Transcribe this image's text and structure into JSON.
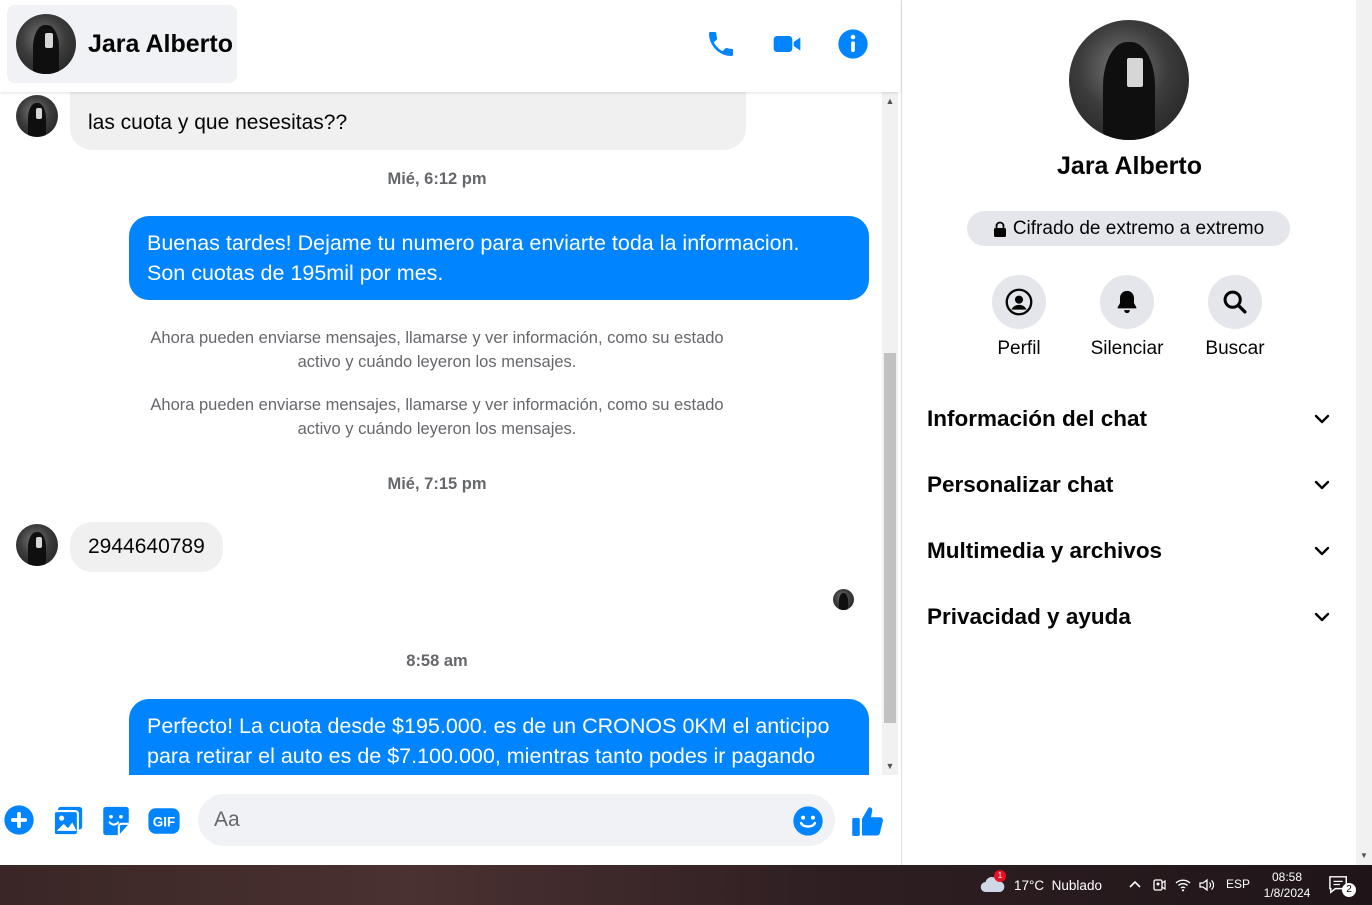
{
  "contact": {
    "name": "Jara Alberto"
  },
  "colors": {
    "accent": "#0084ff",
    "incoming_bubble": "#f0f0f0",
    "meta_text": "#65676b"
  },
  "header": {
    "icons": [
      "phone-icon",
      "video-camera-icon",
      "info-icon"
    ]
  },
  "messages": {
    "first_incoming_partial": "las cuota y que nesesitas??",
    "ts1": "Mié, 6:12 pm",
    "out1_line1": "Buenas tardes! Dejame tu numero para enviarte toda la informacion.",
    "out1_line2": "Son cuotas de 195mil por mes.",
    "system1_line1": "Ahora pueden enviarse mensajes, llamarse y ver información, como su estado",
    "system1_line2": "activo y cuándo leyeron los mensajes.",
    "system2_line1": "Ahora pueden enviarse mensajes, llamarse y ver información, como su estado",
    "system2_line2": "activo y cuándo leyeron los mensajes.",
    "ts2": "Mié, 7:15 pm",
    "in_phone": "2944640789",
    "ts3": "8:58 am",
    "out2_line1": "Perfecto! La cuota desde $195.000. es de un CRONOS 0KM el anticipo",
    "out2_line2": "para retirar el auto es de $7.100.000, mientras tanto podes ir pagando"
  },
  "composer": {
    "placeholder": "Aa",
    "icons": [
      "add-icon",
      "image-icon",
      "sticker-icon",
      "gif-icon",
      "emoji-icon",
      "thumbs-up-icon"
    ],
    "gif_label": "GIF"
  },
  "details": {
    "name": "Jara Alberto",
    "encryption": "Cifrado de extremo a extremo",
    "actions": [
      {
        "label": "Perfil",
        "icon": "profile-icon"
      },
      {
        "label": "Silenciar",
        "icon": "bell-icon"
      },
      {
        "label": "Buscar",
        "icon": "search-icon"
      }
    ],
    "sections": [
      "Información del chat",
      "Personalizar chat",
      "Multimedia y archivos",
      "Privacidad y ayuda"
    ]
  },
  "taskbar": {
    "weather_badge": "1",
    "weather": "17°C  Nublado",
    "language": "ESP",
    "time": "08:58",
    "date": "1/8/2024",
    "notification_count": "2"
  }
}
